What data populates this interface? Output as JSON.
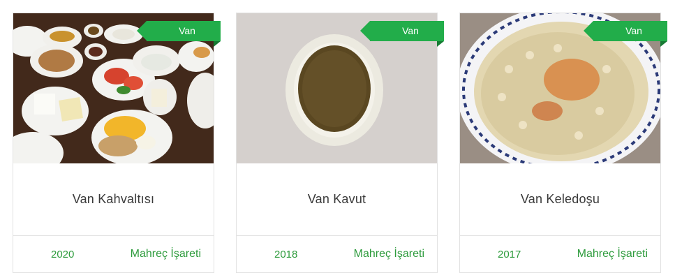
{
  "cards": [
    {
      "region": "Van",
      "title": "Van Kahvaltısı",
      "year": "2020",
      "category": "Mahreç İşareti",
      "image": "breakfast-spread-photo"
    },
    {
      "region": "Van",
      "title": "Van Kavut",
      "year": "2018",
      "category": "Mahreç İşareti",
      "image": "kavut-bowl-photo"
    },
    {
      "region": "Van",
      "title": "Van Keledoşu",
      "year": "2017",
      "category": "Mahreç İşareti",
      "image": "keledosu-plate-photo"
    }
  ],
  "colors": {
    "accent": "#22ad4a",
    "accent_text": "#2d9b3c",
    "border": "#e2e2e2"
  }
}
